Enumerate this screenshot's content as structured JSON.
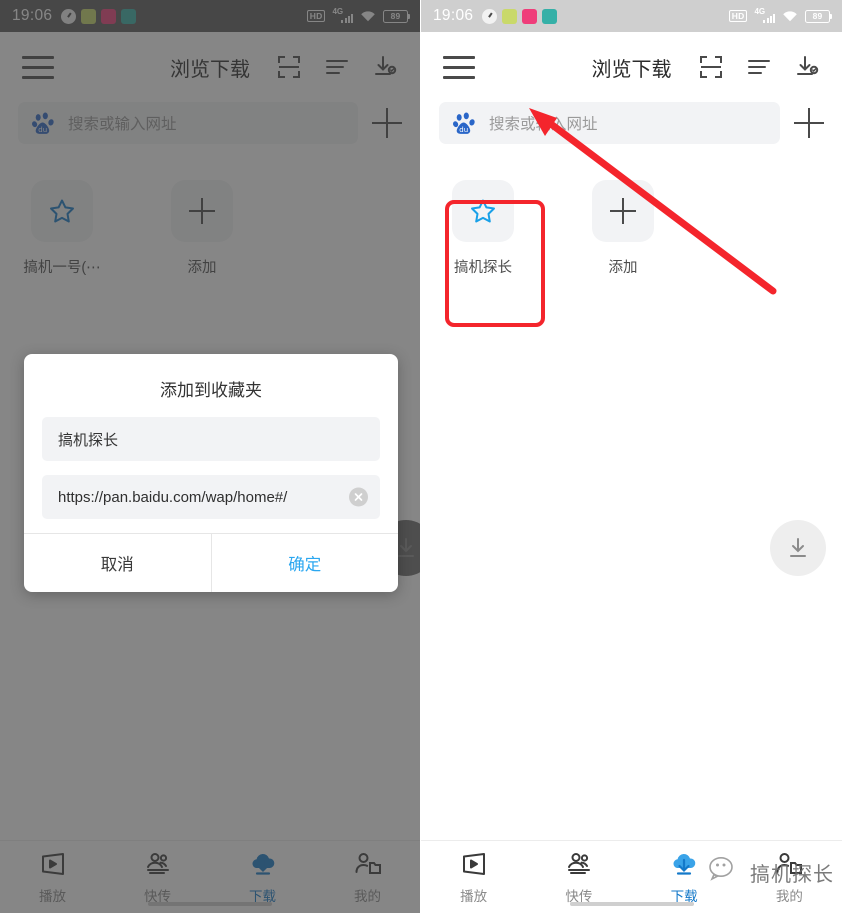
{
  "status_bar": {
    "time": "19:06",
    "hd_label": "HD",
    "network_label": "4G",
    "battery_level": "89",
    "app_icons": [
      "clock-icon",
      "green-app-icon",
      "pink-app-icon",
      "teal-app-icon"
    ]
  },
  "app_bar": {
    "title": "浏览下载",
    "menu_icon": "hamburger-menu-icon",
    "scan_icon": "scan-frame-icon",
    "list_icon": "list-lines-icon",
    "download_icon": "download-check-icon"
  },
  "search": {
    "engine_icon": "baidu-logo-icon",
    "placeholder": "搜索或输入网址",
    "add_icon": "plus-icon"
  },
  "bookmarks_left": [
    {
      "label": "搞机一号(⋯",
      "icon": "star-icon"
    },
    {
      "label": "添加",
      "icon": "plus-icon"
    }
  ],
  "bookmarks_right": [
    {
      "label": "搞机探长",
      "icon": "star-icon"
    },
    {
      "label": "添加",
      "icon": "plus-icon"
    }
  ],
  "fab": {
    "icon": "download-arrow-icon"
  },
  "dialog": {
    "title": "添加到收藏夹",
    "name_value": "搞机探长",
    "url_value": "https://pan.baidu.com/wap/home#/",
    "clear_icon": "clear-circle-icon",
    "cancel_label": "取消",
    "confirm_label": "确定",
    "confirm_color": "#2ba7f0"
  },
  "bottom_nav": [
    {
      "label": "播放",
      "icon": "play-screen-icon",
      "active": false
    },
    {
      "label": "快传",
      "icon": "people-transfer-icon",
      "active": false
    },
    {
      "label": "下载",
      "icon": "cloud-download-icon",
      "active": true
    },
    {
      "label": "我的",
      "icon": "person-folder-icon",
      "active": false
    }
  ],
  "annotation": {
    "highlight_color": "#f4252c",
    "highlight_target": "搞机探长",
    "arrow": "red-arrow-pointing-to-bookmark"
  },
  "watermark": {
    "text": "搞机探长",
    "icon": "wechat-logo-icon"
  }
}
